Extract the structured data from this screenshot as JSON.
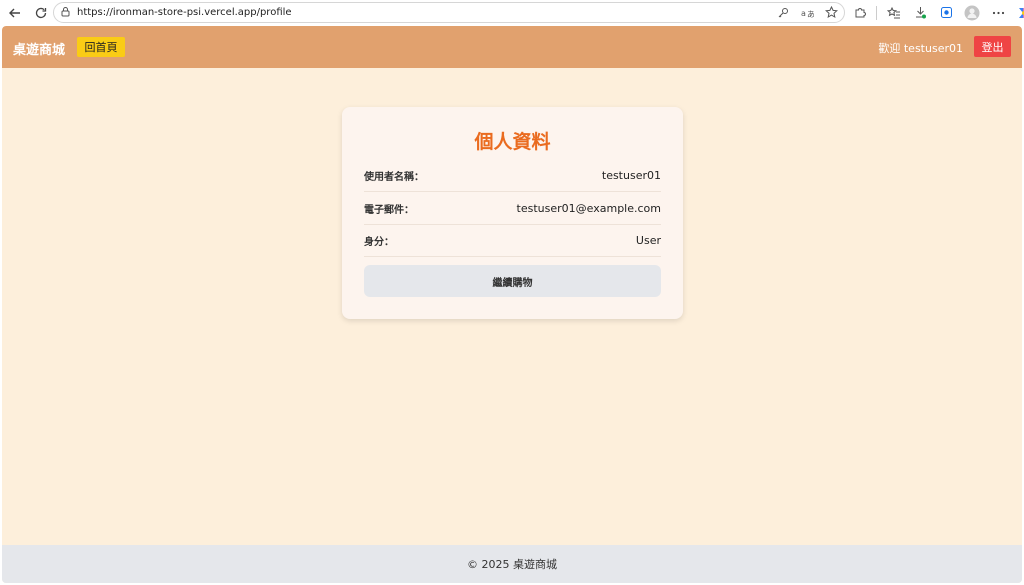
{
  "browser": {
    "url": "https://ironman-store-psi.vercel.app/profile"
  },
  "nav": {
    "brand": "桌遊商城",
    "home_label": "回首頁",
    "welcome": "歡迎 testuser01",
    "logout_label": "登出"
  },
  "profile": {
    "title": "個人資料",
    "fields": [
      {
        "label": "使用者名稱：",
        "value": "testuser01"
      },
      {
        "label": "電子郵件：",
        "value": "testuser01@example.com"
      },
      {
        "label": "身分：",
        "value": "User"
      }
    ],
    "continue_label": "繼續購物"
  },
  "footer": {
    "text": "© 2025 桌遊商城"
  },
  "colors": {
    "nav_bg": "#e1a16e",
    "page_bg": "#fdefdb",
    "home_button": "#facc15",
    "logout_button": "#ef4444",
    "title_color": "#ea6b1f"
  }
}
